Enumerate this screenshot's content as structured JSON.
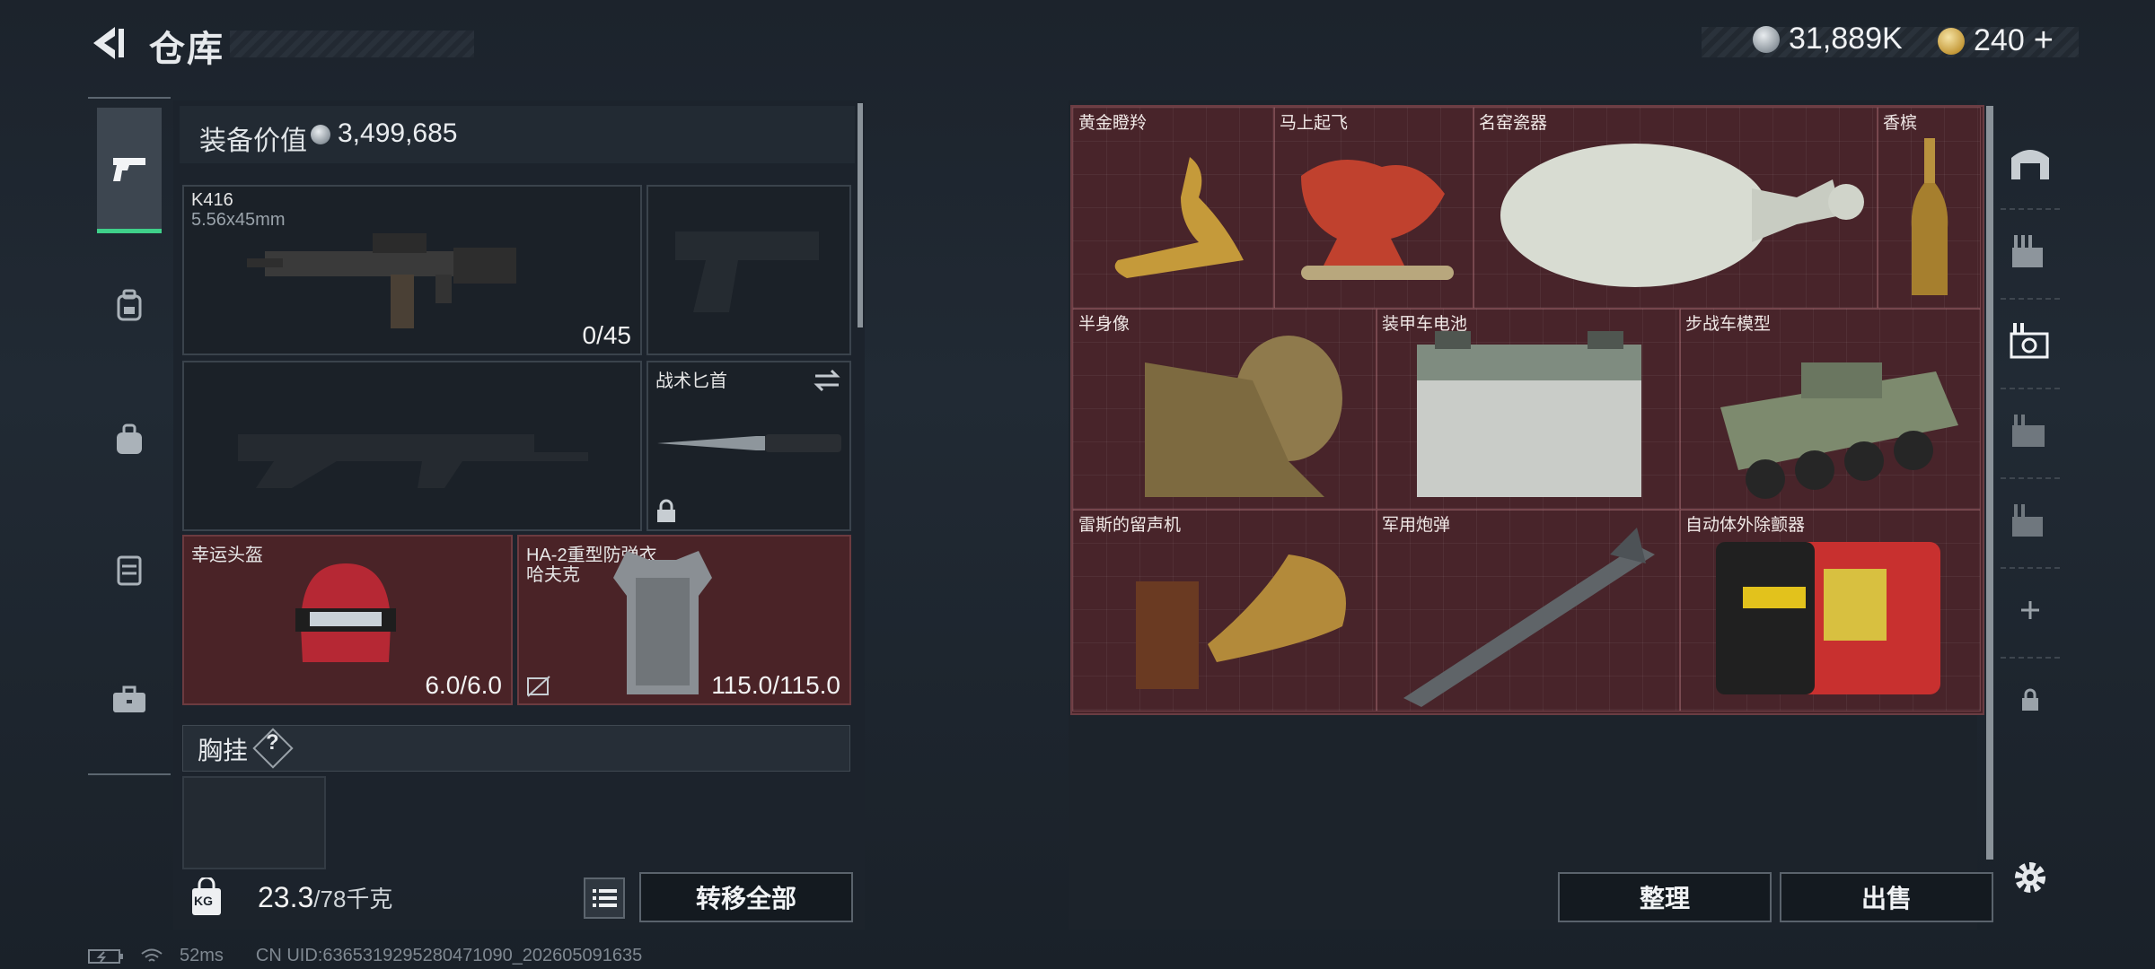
{
  "header": {
    "title": "仓库",
    "currency_silver": "31,889K",
    "currency_gold": "240",
    "gold_plus": "+"
  },
  "equip": {
    "label": "装备价值",
    "value": "3,499,685",
    "primary": {
      "name": "K416",
      "ammo_type": "5.56x45mm",
      "ammo": "0/45"
    },
    "knife": {
      "name": "战术匕首"
    },
    "helmet": {
      "name": "幸运头盔",
      "durability": "6.0/6.0"
    },
    "armor": {
      "name": "HA-2重型防弹衣",
      "subname": "哈夫克",
      "durability": "115.0/115.0"
    },
    "chest_label": "胸挂",
    "chest_help": "?"
  },
  "bottom": {
    "weight": "23.3",
    "weight_max": "/78千克",
    "weight_icon_text": "KG",
    "transfer_all": "转移全部"
  },
  "status": {
    "ping": "52ms",
    "uid": "CN UID:6365319295280471090_202605091635"
  },
  "stash": {
    "items": [
      {
        "name": "黄金瞪羚",
        "color": "#c59a3a",
        "icon": "gazelle-statue"
      },
      {
        "name": "马上起飞",
        "color": "#c0412e",
        "icon": "horse-statue"
      },
      {
        "name": "名窑瓷器",
        "color": "#d8dcd2",
        "icon": "porcelain-vase"
      },
      {
        "name": "香槟",
        "color": "#b8923e",
        "icon": "champagne-bottle"
      },
      {
        "name": "半身像",
        "color": "#8f7a4c",
        "icon": "bust"
      },
      {
        "name": "装甲车电池",
        "color": "#c9ccc8",
        "icon": "battery"
      },
      {
        "name": "步战车模型",
        "color": "#7d8a6e",
        "icon": "ifv-model"
      },
      {
        "name": "雷斯的留声机",
        "color": "#b38a3a",
        "icon": "gramophone"
      },
      {
        "name": "军用炮弹",
        "color": "#5f6468",
        "icon": "missile"
      },
      {
        "name": "自动体外除颤器",
        "color": "#c8302f",
        "icon": "defibrillator"
      }
    ],
    "sort_label": "整理",
    "sell_label": "出售"
  }
}
